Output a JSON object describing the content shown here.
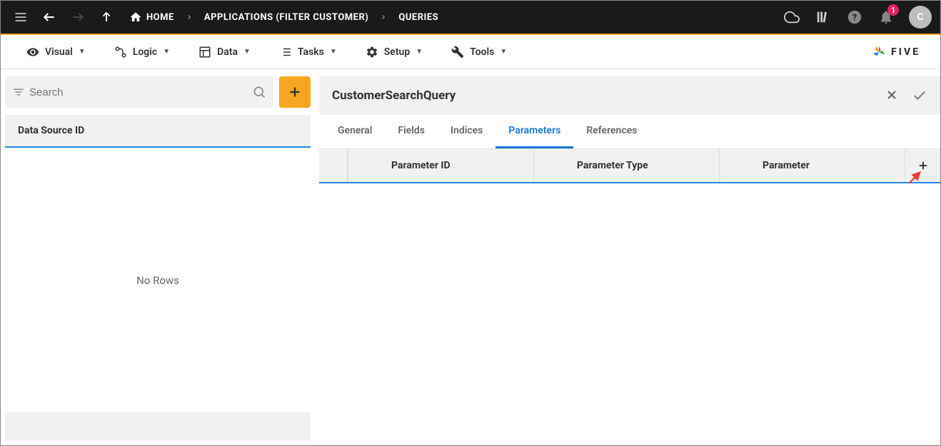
{
  "breadcrumb": {
    "home": "HOME",
    "applications": "APPLICATIONS (FILTER CUSTOMER)",
    "queries": "QUERIES"
  },
  "topbar": {
    "notification_count": "1",
    "avatar_initial": "C"
  },
  "menu": {
    "visual": "Visual",
    "logic": "Logic",
    "data": "Data",
    "tasks": "Tasks",
    "setup": "Setup",
    "tools": "Tools"
  },
  "logo": "FIVE",
  "left": {
    "search_placeholder": "Search",
    "ds_header": "Data Source ID",
    "no_rows": "No Rows"
  },
  "detail": {
    "title": "CustomerSearchQuery",
    "tabs": {
      "general": "General",
      "fields": "Fields",
      "indices": "Indices",
      "parameters": "Parameters",
      "references": "References"
    },
    "columns": {
      "parameter_id": "Parameter ID",
      "parameter_type": "Parameter Type",
      "parameter": "Parameter"
    }
  }
}
